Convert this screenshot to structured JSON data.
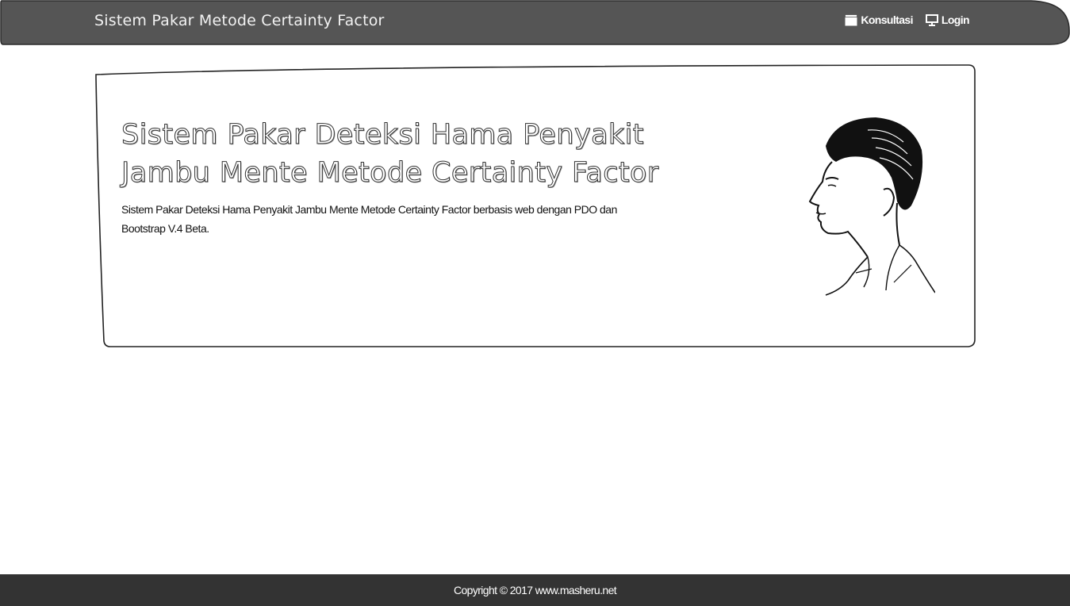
{
  "navbar": {
    "brand": "Sistem Pakar Metode Certainty Factor",
    "links": [
      {
        "label": "Konsultasi",
        "icon": "book-icon"
      },
      {
        "label": "Login",
        "icon": "monitor-icon"
      }
    ]
  },
  "hero": {
    "title": "Sistem Pakar Deteksi Hama Penyakit Jambu Mente Metode Certainty Factor",
    "description": "Sistem Pakar Deteksi Hama Penyakit Jambu Mente Metode Certainty Factor berbasis web dengan PDO dan Bootstrap V.4 Beta."
  },
  "footer": {
    "copyright": "Copyright © 2017 www.masheru.net"
  },
  "colors": {
    "navbar_bg": "#555555",
    "footer_bg": "#333333",
    "border": "#333333"
  }
}
